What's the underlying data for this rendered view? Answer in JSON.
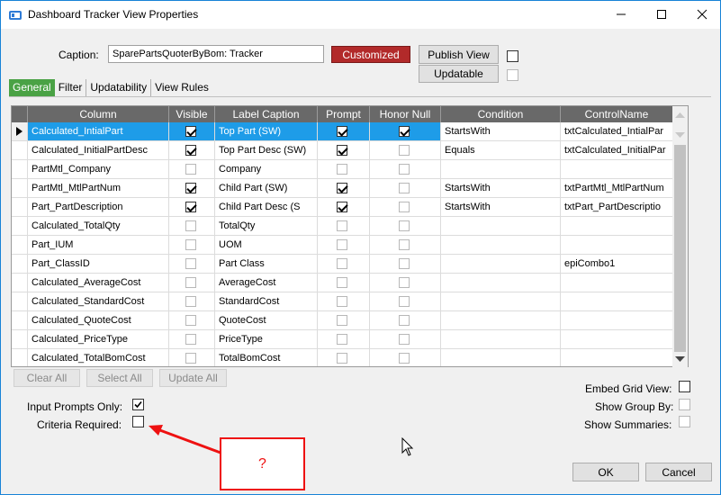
{
  "window": {
    "title": "Dashboard Tracker View Properties"
  },
  "caption": {
    "label": "Caption:",
    "value": "SparePartsQuoterByBom: Tracker"
  },
  "buttons": {
    "customized": "Customized",
    "publish_view": "Publish View",
    "updatable": "Updatable",
    "clear_all": "Clear All",
    "select_all": "Select All",
    "update_all": "Update All",
    "ok": "OK",
    "cancel": "Cancel"
  },
  "tabs": [
    "General",
    "Filter",
    "Updatability",
    "View Rules"
  ],
  "grid": {
    "columns": [
      "Column",
      "Visible",
      "Label Caption",
      "Prompt",
      "Honor Null",
      "Condition",
      "ControlName"
    ],
    "rows": [
      {
        "column": "Calculated_IntialPart",
        "visible": true,
        "label": "Top Part (SW)",
        "prompt": true,
        "honor_null": true,
        "condition": "StartsWith",
        "control": "txtCalculated_IntialPar"
      },
      {
        "column": "Calculated_InitialPartDesc",
        "visible": true,
        "label": "Top Part Desc (SW)",
        "prompt": true,
        "honor_null": false,
        "condition": "Equals",
        "control": "txtCalculated_InitialPar"
      },
      {
        "column": "PartMtl_Company",
        "visible": false,
        "label": "Company",
        "prompt": false,
        "honor_null": false,
        "condition": "",
        "control": ""
      },
      {
        "column": "PartMtl_MtlPartNum",
        "visible": true,
        "label": "Child Part (SW)",
        "prompt": true,
        "honor_null": false,
        "condition": "StartsWith",
        "control": "txtPartMtl_MtlPartNum"
      },
      {
        "column": "Part_PartDescription",
        "visible": true,
        "label": "Child Part Desc (S",
        "prompt": true,
        "honor_null": false,
        "condition": "StartsWith",
        "control": "txtPart_PartDescriptio"
      },
      {
        "column": "Calculated_TotalQty",
        "visible": false,
        "label": "TotalQty",
        "prompt": false,
        "honor_null": false,
        "condition": "",
        "control": ""
      },
      {
        "column": "Part_IUM",
        "visible": false,
        "label": "UOM",
        "prompt": false,
        "honor_null": false,
        "condition": "",
        "control": ""
      },
      {
        "column": "Part_ClassID",
        "visible": false,
        "label": "Part Class",
        "prompt": false,
        "honor_null": false,
        "condition": "",
        "control": "epiCombo1"
      },
      {
        "column": "Calculated_AverageCost",
        "visible": false,
        "label": "AverageCost",
        "prompt": false,
        "honor_null": false,
        "condition": "",
        "control": ""
      },
      {
        "column": "Calculated_StandardCost",
        "visible": false,
        "label": "StandardCost",
        "prompt": false,
        "honor_null": false,
        "condition": "",
        "control": ""
      },
      {
        "column": "Calculated_QuoteCost",
        "visible": false,
        "label": "QuoteCost",
        "prompt": false,
        "honor_null": false,
        "condition": "",
        "control": ""
      },
      {
        "column": "Calculated_PriceType",
        "visible": false,
        "label": "PriceType",
        "prompt": false,
        "honor_null": false,
        "condition": "",
        "control": ""
      },
      {
        "column": "Calculated_TotalBomCost",
        "visible": false,
        "label": "TotalBomCost",
        "prompt": false,
        "honor_null": false,
        "condition": "",
        "control": ""
      }
    ]
  },
  "options": {
    "input_prompts_only": "Input Prompts Only:",
    "criteria_required": "Criteria Required:",
    "embed_grid_view": "Embed Grid View:",
    "show_group_by": "Show Group By:",
    "show_summaries": "Show Summaries:"
  },
  "annotation": {
    "text": "?",
    "color": "#ee1111"
  },
  "colors": {
    "selected_row": "#1e9ce8",
    "active_tab": "#4aa245",
    "customized": "#b22a2a",
    "header": "#696969"
  }
}
